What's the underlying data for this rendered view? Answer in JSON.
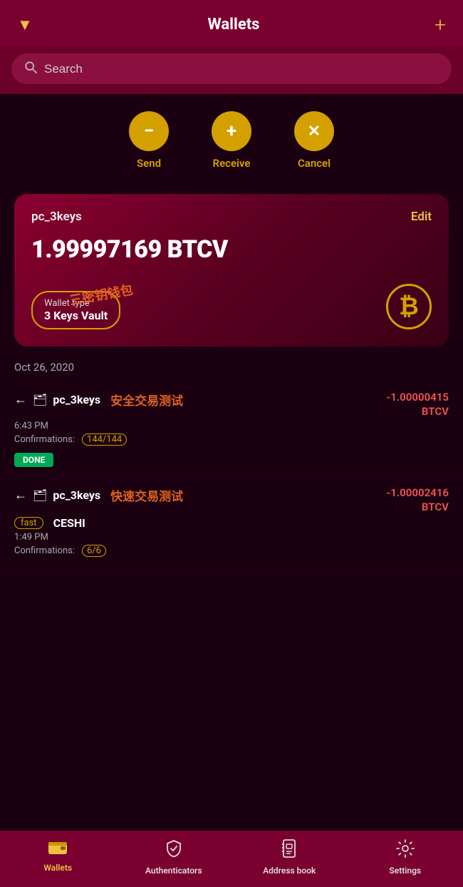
{
  "header": {
    "title": "Wallets",
    "filter_icon": "▼",
    "add_icon": "+"
  },
  "search": {
    "placeholder": "Search"
  },
  "actions": [
    {
      "id": "send",
      "icon": "−",
      "label": "Send"
    },
    {
      "id": "receive",
      "icon": "+",
      "label": "Receive"
    },
    {
      "id": "cancel",
      "icon": "✕",
      "label": "Cancel"
    }
  ],
  "wallet": {
    "name": "pc_3keys",
    "edit_label": "Edit",
    "balance": "1.99997169 BTCV",
    "type_label": "Wallet type",
    "type_value": "3 Keys Vault",
    "annotation": "三密钥钱包"
  },
  "date_separator": "Oct 26, 2020",
  "transactions": [
    {
      "id": "tx1",
      "direction": "←",
      "wallet_icon": "🗂",
      "name": "pc_3keys",
      "annotation": "安全交易测试",
      "amount_line1": "-1.00000415",
      "amount_line2": "BTCV",
      "time": "6:43 PM",
      "confirmations_label": "Confirmations:",
      "confirmations_value": "144/144",
      "badge": "DONE"
    },
    {
      "id": "tx2",
      "direction": "←",
      "wallet_icon": "🗂",
      "name": "pc_3keys",
      "annotation": "快速交易测试",
      "fast_label": "fast",
      "sub_name": "CESHI",
      "amount_line1": "-1.00002416",
      "amount_line2": "BTCV",
      "time": "1:49 PM",
      "confirmations_label": "Confirmations:",
      "confirmations_value": "6/6"
    }
  ],
  "nav": [
    {
      "id": "wallets",
      "icon": "wallet",
      "label": "Wallets",
      "active": true
    },
    {
      "id": "authenticators",
      "icon": "shield",
      "label": "Authenticators",
      "active": false
    },
    {
      "id": "address-book",
      "icon": "book",
      "label": "Address book",
      "active": false
    },
    {
      "id": "settings",
      "icon": "gear",
      "label": "Settings",
      "active": false
    }
  ]
}
